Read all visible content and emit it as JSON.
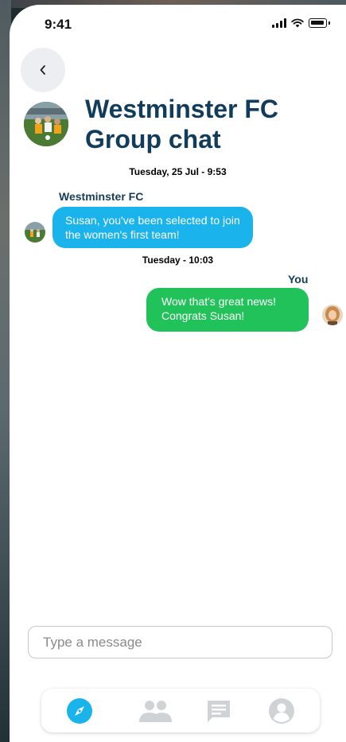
{
  "status_bar": {
    "time": "9:41"
  },
  "chat": {
    "title": "Westminster FC Group chat",
    "messages": [
      {
        "timestamp": "Tuesday, 25 Jul - 9:53",
        "sender": "Westminster FC",
        "text": "Susan, you've been selected to join the women's first team!",
        "direction": "incoming"
      },
      {
        "timestamp": "Tuesday - 10:03",
        "sender": "You",
        "text": "Wow that's great news! Congrats Susan!",
        "direction": "outgoing"
      }
    ]
  },
  "composer": {
    "placeholder": "Type a message"
  },
  "tabs": [
    {
      "icon": "compass-icon",
      "active": true
    },
    {
      "icon": "people-icon",
      "active": false
    },
    {
      "icon": "chat-icon",
      "active": false
    },
    {
      "icon": "profile-icon",
      "active": false
    }
  ],
  "colors": {
    "title": "#123c5c",
    "incoming_bubble": "#1ab3ec",
    "outgoing_bubble": "#22c25a",
    "active_tab": "#1ab3ec",
    "inactive_tab": "#d0d3d6"
  }
}
